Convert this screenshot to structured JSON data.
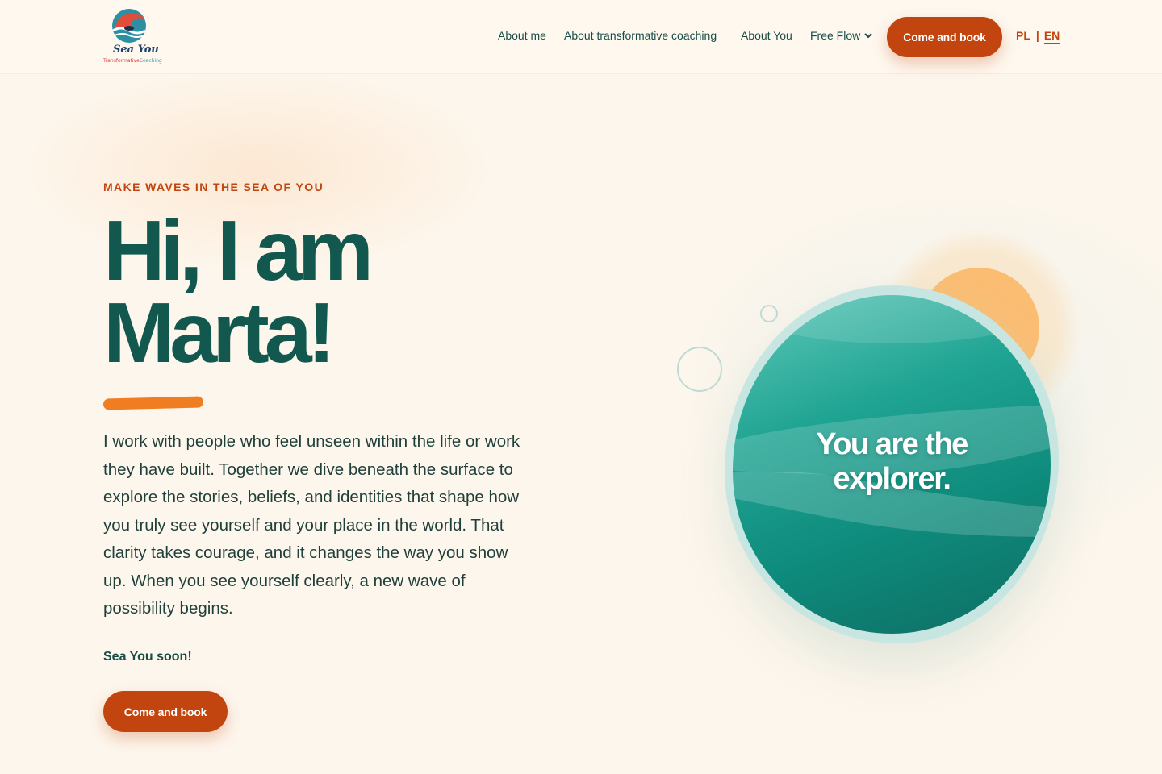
{
  "brand": {
    "name": "Sea You",
    "tagline_part1": "Transformative",
    "tagline_part2": "Coaching"
  },
  "nav": {
    "items": [
      "About me",
      "About transformative coaching",
      "About You",
      "Free Flow"
    ],
    "cta": "Come and book",
    "languages": [
      "PL",
      "EN"
    ],
    "active_language": "EN"
  },
  "hero": {
    "eyebrow": "MAKE WAVES IN THE SEA OF YOU",
    "title_line1": "Hi, I am",
    "title_line2": "Marta!",
    "intro": "I work with people who feel unseen within the life or work they have built. Together we dive beneath the surface to explore the stories, beliefs, and identities that shape how you truly see yourself and your place in the world. That clarity takes courage, and it changes the way you show up. When you see yourself clearly, a new wave of possibility begins.",
    "signoff": "Sea You soon!",
    "cta": "Come and book"
  },
  "visual": {
    "line1": "You are the",
    "line2": "explorer."
  },
  "colors": {
    "background": "#fdf6ec",
    "primary_teal": "#12584f",
    "accent_orange": "#c2450f",
    "underline_orange": "#f07d22",
    "sun": "#fbbd72"
  }
}
